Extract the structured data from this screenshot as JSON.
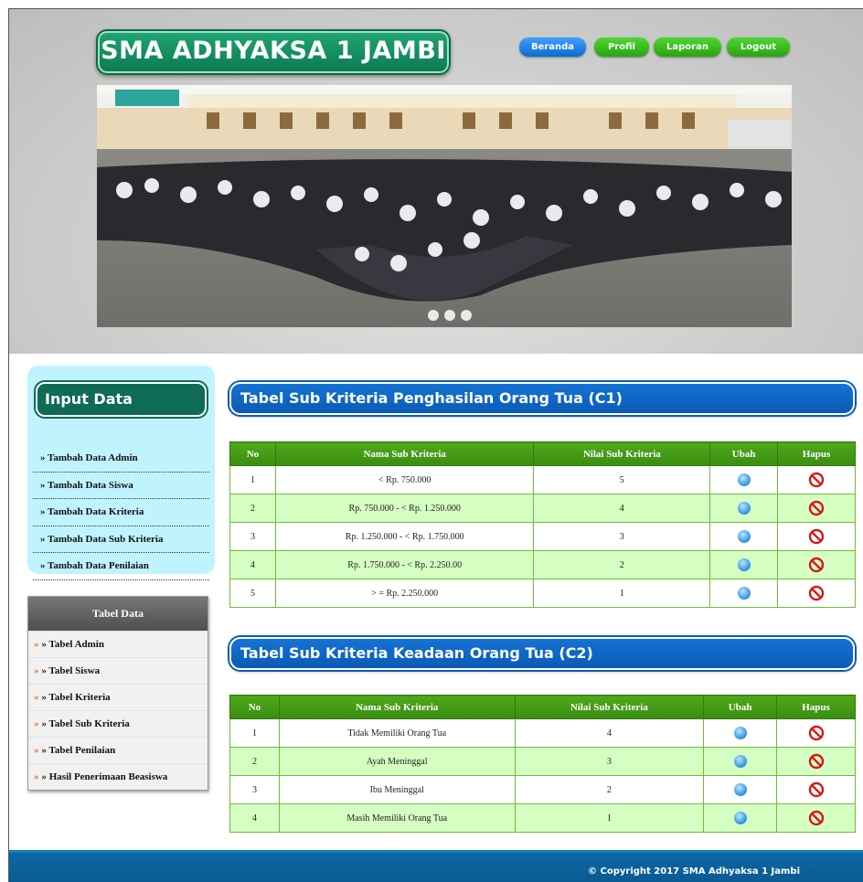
{
  "site": {
    "title": "SMA ADHYAKSA 1 JAMBI"
  },
  "nav": [
    {
      "label": "Beranda",
      "color": "#0a6cd0"
    },
    {
      "label": "Profil",
      "color": "#2aa312"
    },
    {
      "label": "Laporan",
      "color": "#2aa312"
    },
    {
      "label": "Logout",
      "color": "#2aa312"
    }
  ],
  "banner": {
    "slides": 3
  },
  "input_data": {
    "title": "Input Data",
    "items": [
      "» Tambah Data Admin",
      "» Tambah Data Siswa",
      "» Tambah Data Kriteria",
      "» Tambah Data Sub Kriteria",
      "» Tambah Data Penilaian"
    ]
  },
  "tabel_data": {
    "title": "Tabel Data",
    "items": [
      "» Tabel Admin",
      "» Tabel Siswa",
      "» Tabel Kriteria",
      "» Tabel Sub Kriteria",
      "» Tabel Penilaian",
      "» Hasil Penerimaan Beasiswa"
    ]
  },
  "table1": {
    "title": "Tabel Sub Kriteria Penghasilan Orang Tua (C1)",
    "headers": [
      "No",
      "Nama Sub Kriteria",
      "Nilai Sub Kriteria",
      "Ubah",
      "Hapus"
    ],
    "rows": [
      {
        "no": "1",
        "nama": "< Rp. 750.000",
        "nilai": "5"
      },
      {
        "no": "2",
        "nama": "Rp. 750.000 - < Rp. 1.250.000",
        "nilai": "4"
      },
      {
        "no": "3",
        "nama": "Rp. 1.250.000 - < Rp. 1.750.000",
        "nilai": "3"
      },
      {
        "no": "4",
        "nama": "Rp. 1.750.000 - < Rp. 2.250.00",
        "nilai": "2"
      },
      {
        "no": "5",
        "nama": "> = Rp. 2.250.000",
        "nilai": "1"
      }
    ]
  },
  "table2": {
    "title": "Tabel Sub Kriteria Keadaan Orang Tua (C2)",
    "headers": [
      "No",
      "Nama Sub Kriteria",
      "Nilai Sub Kriteria",
      "Ubah",
      "Hapus"
    ],
    "rows": [
      {
        "no": "1",
        "nama": "Tidak Memiliki Orang Tua",
        "nilai": "4"
      },
      {
        "no": "2",
        "nama": "Ayah Meninggal",
        "nilai": "3"
      },
      {
        "no": "3",
        "nama": "Ibu Meninggal",
        "nilai": "2"
      },
      {
        "no": "4",
        "nama": "Masih Memiliki Orang Tua",
        "nilai": "1"
      }
    ]
  },
  "icons": {
    "ubah": "edit-icon",
    "hapus": "delete-icon"
  },
  "footer": {
    "copyright": "© Copyright 2017 SMA Adhyaksa 1 Jambi"
  }
}
